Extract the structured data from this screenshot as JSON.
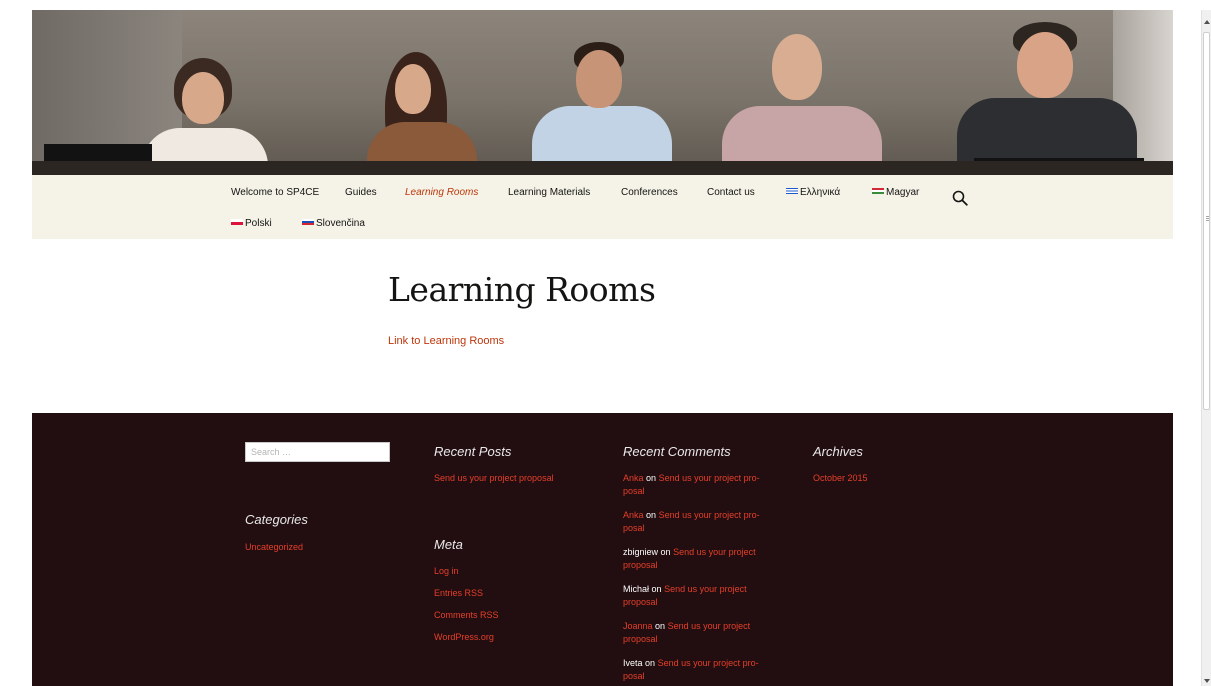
{
  "nav": {
    "items": [
      {
        "label": "Welcome to SP4CE"
      },
      {
        "label": "Guides"
      },
      {
        "label": "Learning Rooms"
      },
      {
        "label": "Learning Materials"
      },
      {
        "label": "Conferences"
      },
      {
        "label": "Contact us"
      },
      {
        "label": "Ελληνικά",
        "icon": "greek-flag-icon"
      },
      {
        "label": "Magyar",
        "icon": "hungarian-flag-icon"
      },
      {
        "label": "Polski",
        "icon": "polish-flag-icon"
      },
      {
        "label": "Slovenčina",
        "icon": "slovak-flag-icon"
      }
    ],
    "current": "Learning Rooms",
    "search_icon": "search-icon"
  },
  "page": {
    "title": "Learning Rooms",
    "link": "Link to Learning Rooms"
  },
  "footer": {
    "search": {
      "placeholder": "Search …",
      "value": ""
    },
    "categories": {
      "title": "Categories",
      "items": [
        "Uncategorized"
      ]
    },
    "recent_posts": {
      "title": "Recent Posts",
      "items": [
        "Send us your project proposal"
      ]
    },
    "meta": {
      "title": "Meta",
      "items": [
        "Log in",
        "Entries RSS",
        "Comments RSS",
        "WordPress.org"
      ]
    },
    "recent_comments": {
      "title": "Recent Comments",
      "connector": "on",
      "items": [
        {
          "author": "Anka",
          "author_linked": true,
          "post_line1": "Send us your project pro-",
          "post_line2": "posal"
        },
        {
          "author": "Anka",
          "author_linked": true,
          "post_line1": "Send us your project pro-",
          "post_line2": "posal"
        },
        {
          "author": "zbigniew",
          "author_linked": false,
          "post_line1": "Send us your project",
          "post_line2": "proposal"
        },
        {
          "author": "Michał",
          "author_linked": false,
          "post_line1": "Send us your project",
          "post_line2": "proposal"
        },
        {
          "author": "Joanna",
          "author_linked": true,
          "post_line1": "Send us your project",
          "post_line2": "proposal"
        },
        {
          "author": "Iveta",
          "author_linked": false,
          "post_line1": "Send us your project pro-",
          "post_line2": "posal"
        }
      ]
    },
    "archives": {
      "title": "Archives",
      "items": [
        "October 2015"
      ]
    }
  },
  "colors": {
    "nav_background": "#f5f3e8",
    "accent": "#bc360a",
    "footer_background": "#220e10",
    "footer_link": "#e63f2a"
  }
}
